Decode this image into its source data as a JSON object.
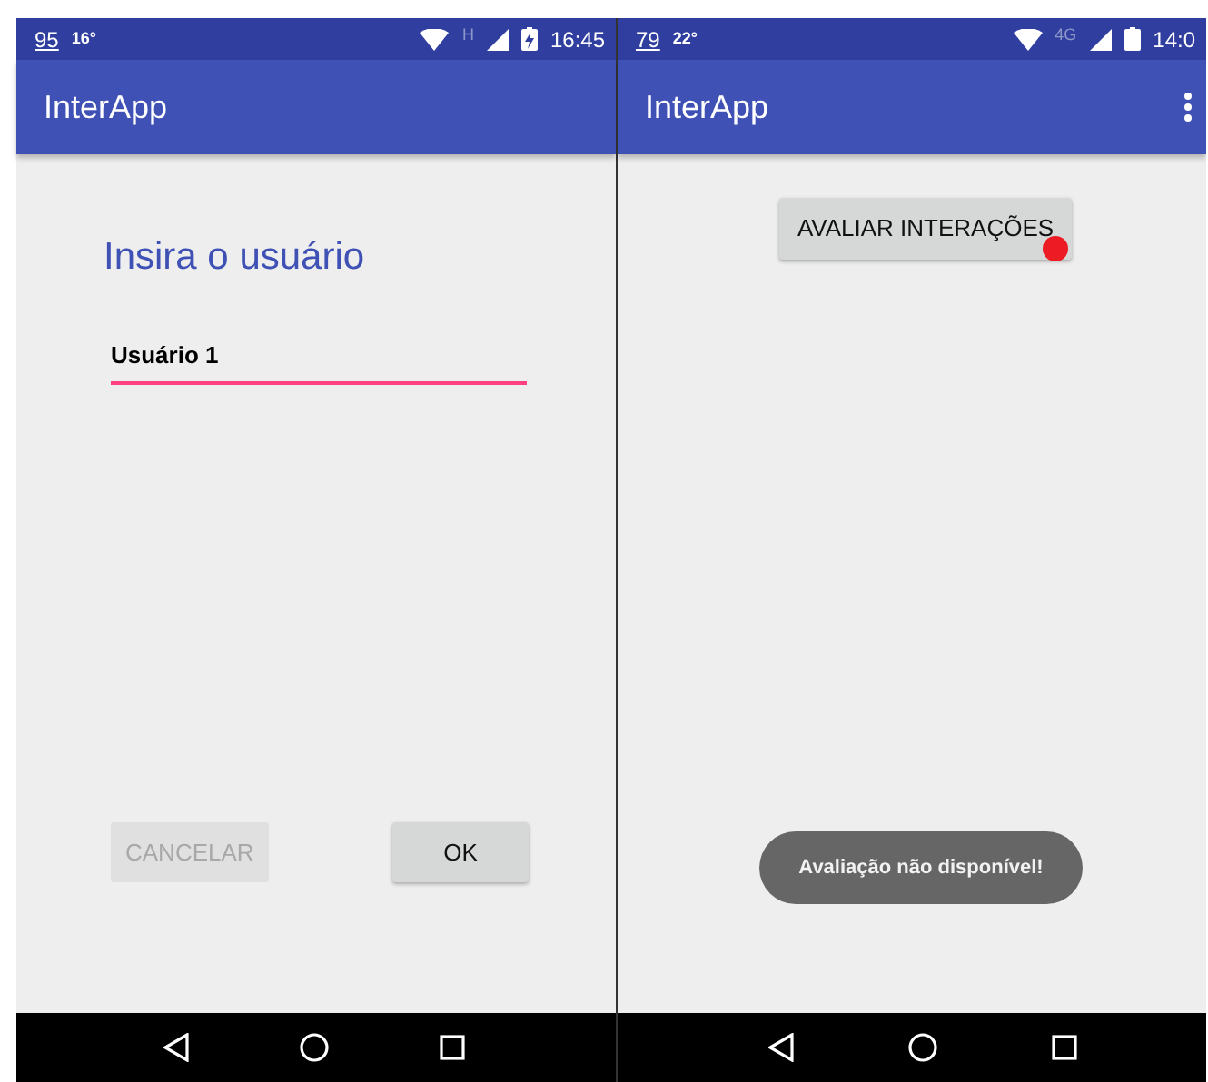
{
  "screens": [
    {
      "kind": "login",
      "status_bar": {
        "notifications": [
          "95",
          "16°"
        ],
        "network": "H",
        "time": "16:45",
        "charging": true
      },
      "app_bar": {
        "title": "InterApp",
        "menu": false
      },
      "heading": "Insira o usuário",
      "field": {
        "value": "Usuário 1"
      },
      "buttons": [
        {
          "label": "CANCELAR",
          "disabled": true
        },
        {
          "label": "OK",
          "disabled": false
        }
      ]
    },
    {
      "kind": "evaluate",
      "status_bar": {
        "notifications": [
          "79",
          "22°"
        ],
        "network": "4G",
        "time": "14:0",
        "charging": false
      },
      "app_bar": {
        "title": "InterApp",
        "menu": true
      },
      "button": {
        "label": "AVALIAR INTERAÇÕES",
        "touch_dot": true
      },
      "toast": "Avaliação não disponível!"
    }
  ]
}
